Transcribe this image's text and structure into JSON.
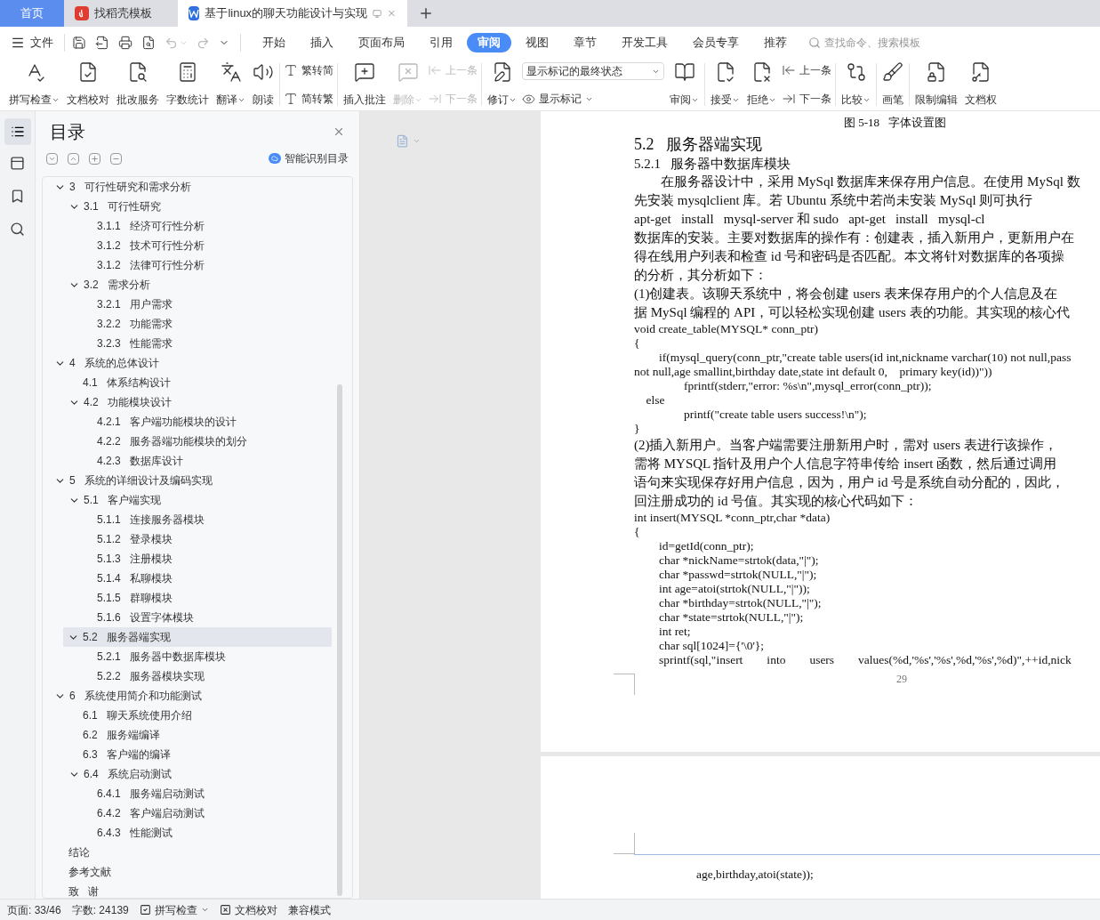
{
  "tabs": [
    {
      "kind": "home",
      "label": "首页",
      "selected": false
    },
    {
      "kind": "template",
      "label": "找稻壳模板",
      "selected": false
    },
    {
      "kind": "document",
      "label": "基于linux的聊天功能设计与实现",
      "selected": true
    }
  ],
  "menu": {
    "file": "文件",
    "tabs": [
      {
        "label": "开始",
        "selected": false
      },
      {
        "label": "插入",
        "selected": false
      },
      {
        "label": "页面布局",
        "selected": false
      },
      {
        "label": "引用",
        "selected": false
      },
      {
        "label": "审阅",
        "selected": true
      },
      {
        "label": "视图",
        "selected": false
      },
      {
        "label": "章节",
        "selected": false
      },
      {
        "label": "开发工具",
        "selected": false
      },
      {
        "label": "会员专享",
        "selected": false
      },
      {
        "label": "推荐",
        "selected": false
      }
    ],
    "search_placeholder": "查找命令、搜索模板"
  },
  "toolbar": [
    [
      {
        "kind": "big",
        "label": "拼写检查",
        "caret": true,
        "disabled": false
      },
      {
        "kind": "big",
        "label": "文档校对",
        "caret": false,
        "disabled": false
      },
      {
        "kind": "big",
        "label": "批改服务",
        "caret": false,
        "disabled": false
      },
      {
        "kind": "big",
        "label": "字数统计",
        "caret": false,
        "disabled": false
      },
      {
        "kind": "big",
        "label": "翻译",
        "caret": true,
        "disabled": false
      },
      {
        "kind": "big",
        "label": "朗读",
        "caret": false,
        "disabled": false
      }
    ],
    [
      {
        "kind": "pair",
        "items": [
          {
            "label": "繁转简",
            "disabled": false
          },
          {
            "label": "简转繁",
            "disabled": false
          }
        ]
      }
    ],
    [
      {
        "kind": "big",
        "label": "插入批注",
        "caret": false,
        "disabled": false
      },
      {
        "kind": "big",
        "label": "删除",
        "caret": true,
        "disabled": true
      },
      {
        "kind": "pair",
        "items": [
          {
            "label": "上一条",
            "disabled": true
          },
          {
            "label": "下一条",
            "disabled": true
          }
        ]
      }
    ],
    [
      {
        "kind": "big",
        "label": "修订",
        "caret": true,
        "disabled": false
      },
      {
        "kind": "combo",
        "value": "显示标记的最终状态",
        "button": "显示标记"
      },
      {
        "kind": "big",
        "label": "审阅",
        "caret": true,
        "disabled": false
      }
    ],
    [
      {
        "kind": "big",
        "label": "接受",
        "caret": true,
        "disabled": false
      },
      {
        "kind": "big",
        "label": "拒绝",
        "caret": true,
        "disabled": false
      },
      {
        "kind": "pair",
        "items": [
          {
            "label": "上一条",
            "disabled": false
          },
          {
            "label": "下一条",
            "disabled": false
          }
        ]
      }
    ],
    [
      {
        "kind": "big",
        "label": "比较",
        "caret": true,
        "disabled": false
      }
    ],
    [
      {
        "kind": "big",
        "label": "画笔",
        "caret": false,
        "disabled": false
      }
    ],
    [
      {
        "kind": "big",
        "label": "限制编辑",
        "caret": false,
        "disabled": false
      },
      {
        "kind": "big",
        "label": "文档权",
        "caret": false,
        "disabled": false
      }
    ]
  ],
  "toc": {
    "title": "目录",
    "smart_button": "智能识别目录",
    "items": [
      {
        "label": "3   可行性研究和需求分析",
        "selected": false,
        "expanded": true,
        "children": [
          {
            "label": "3.1   可行性研究",
            "selected": false,
            "expanded": true,
            "children": [
              {
                "label": "3.1.1   经济可行性分析",
                "selected": false
              },
              {
                "label": "3.1.2   技术可行性分析",
                "selected": false
              },
              {
                "label": "3.1.2   法律可行性分析",
                "selected": false
              }
            ]
          },
          {
            "label": "3.2   需求分析",
            "selected": false,
            "expanded": true,
            "children": [
              {
                "label": "3.2.1   用户需求",
                "selected": false
              },
              {
                "label": "3.2.2   功能需求",
                "selected": false
              },
              {
                "label": "3.2.3   性能需求",
                "selected": false
              }
            ]
          }
        ]
      },
      {
        "label": "4   系统的总体设计",
        "selected": false,
        "expanded": true,
        "children": [
          {
            "label": "4.1   体系结构设计",
            "selected": false
          },
          {
            "label": "4.2   功能模块设计",
            "selected": false,
            "expanded": true,
            "children": [
              {
                "label": "4.2.1   客户端功能模块的设计",
                "selected": false
              },
              {
                "label": "4.2.2   服务器端功能模块的划分",
                "selected": false
              },
              {
                "label": "4.2.3   数据库设计",
                "selected": false
              }
            ]
          }
        ]
      },
      {
        "label": "5   系统的详细设计及编码实现",
        "selected": false,
        "expanded": true,
        "children": [
          {
            "label": "5.1   客户端实现",
            "selected": false,
            "expanded": true,
            "children": [
              {
                "label": "5.1.1   连接服务器模块",
                "selected": false
              },
              {
                "label": "5.1.2   登录模块",
                "selected": false
              },
              {
                "label": "5.1.3   注册模块",
                "selected": false
              },
              {
                "label": "5.1.4   私聊模块",
                "selected": false
              },
              {
                "label": "5.1.5   群聊模块",
                "selected": false
              },
              {
                "label": "5.1.6   设置字体模块",
                "selected": false
              }
            ]
          },
          {
            "label": "5.2   服务器端实现",
            "selected": true,
            "expanded": true,
            "children": [
              {
                "label": "5.2.1   服务器中数据库模块",
                "selected": false
              },
              {
                "label": "5.2.2   服务器模块实现",
                "selected": false
              }
            ]
          }
        ]
      },
      {
        "label": "6   系统使用简介和功能测试",
        "selected": false,
        "expanded": true,
        "children": [
          {
            "label": "6.1   聊天系统使用介绍",
            "selected": false
          },
          {
            "label": "6.2   服务端编译",
            "selected": false
          },
          {
            "label": "6.3   客户端的编译",
            "selected": false
          },
          {
            "label": "6.4   系统启动测试",
            "selected": false,
            "expanded": true,
            "children": [
              {
                "label": "6.4.1   服务端启动测试",
                "selected": false
              },
              {
                "label": "6.4.2   客户端启动测试",
                "selected": false
              },
              {
                "label": "6.4.3   性能测试",
                "selected": false
              }
            ]
          }
        ]
      },
      {
        "label": "结论",
        "selected": false
      },
      {
        "label": "参考文献",
        "selected": false
      },
      {
        "label": "致   谢",
        "selected": false
      }
    ]
  },
  "document": {
    "caption": "图 5-18   字体设置图",
    "blocks": [
      {
        "kind": "heading1",
        "text": "5.2   服务器端实现"
      },
      {
        "kind": "heading2",
        "text": "5.2.1   服务器中数据库模块"
      },
      {
        "kind": "paragraph",
        "lines": [
          "　　在服务器设计中，采用 MySql 数据库来保存用户信息。在使用 MySql 数",
          "先安装 mysqlclient 库。若 Ubuntu 系统中若尚未安装 MySql 则可执行",
          "apt-get   install   mysql-server 和 sudo   apt-get   install   mysql-cl",
          "数据库的安装。主要对数据库的操作有：创建表，插入新用户，更新用户在",
          "得在线用户列表和检查 id 号和密码是否匹配。本文将针对数据库的各项操",
          "的分析，其分析如下："
        ]
      },
      {
        "kind": "paragraph",
        "lines": [
          "(1)创建表。该聊天系统中，将会创建 users 表来保存用户的个人信息及在",
          "据 MySql 编程的 API，可以轻松实现创建 users 表的功能。其实现的核心代"
        ]
      },
      {
        "kind": "code",
        "lines": [
          "void create_table(MYSQL* conn_ptr)",
          "{",
          "\tif(mysql_query(conn_ptr,\"create table users(id int,nickname varchar(10) not null,pass",
          "not null,age smallint,birthday date,state int default 0,    primary key(id))\"))",
          "\t\tfprintf(stderr,\"error: %s\\n\",mysql_error(conn_ptr));",
          "    else",
          "\t\tprintf(\"create table users success!\\n\");",
          "}"
        ]
      },
      {
        "kind": "paragraph",
        "lines": [
          "(2)插入新用户。当客户端需要注册新用户时，需对 users 表进行该操作，",
          "需将 MYSQL 指针及用户个人信息字符串传给 insert 函数，然后通过调用",
          "语句来实现保存好用户信息，因为，用户 id 号是系统自动分配的，因此，",
          "回注册成功的 id 号值。其实现的核心代码如下："
        ]
      },
      {
        "kind": "code",
        "lines": [
          "int insert(MYSQL *conn_ptr,char *data)",
          "{",
          "\tid=getId(conn_ptr);",
          "\tchar *nickName=strtok(data,\"|\");",
          "\tchar *passwd=strtok(NULL,\"|\");",
          "\tint age=atoi(strtok(NULL,\"|\"));",
          "\tchar *birthday=strtok(NULL,\"|\");",
          "\tchar *state=strtok(NULL,\"|\");",
          "\tint ret;",
          "\tchar sql[1024]={'\\0'};",
          "\tsprintf(sql,\"insert        into        users        values(%d,'%s','%s',%d,'%s',%d)\",++id,nick"
        ]
      }
    ],
    "page_number": "29",
    "next_page_lines": [
      "\t\tage,birthday,atoi(state));"
    ]
  },
  "status_bar": {
    "page": "页面: 33/46",
    "words": "字数: 24139",
    "spell": "拼写检查",
    "proof": "文档校对",
    "mode": "兼容模式"
  }
}
